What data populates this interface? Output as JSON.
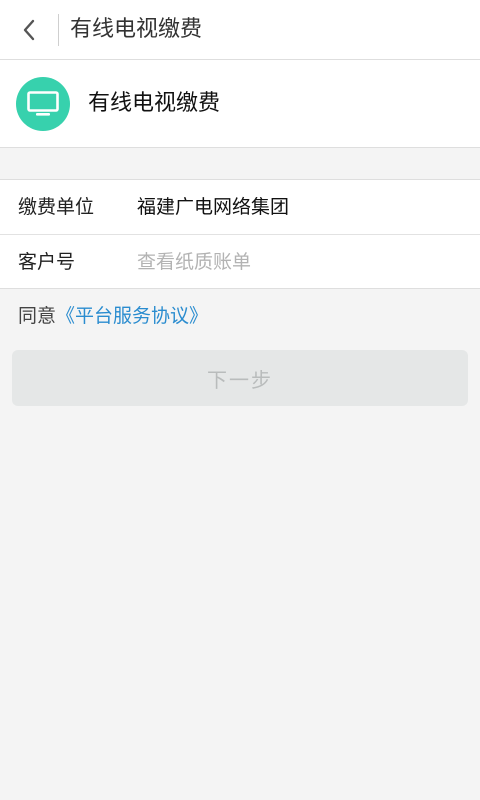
{
  "header": {
    "title": "有线电视缴费"
  },
  "service": {
    "name": "有线电视缴费",
    "icon": "tv-icon",
    "icon_color": "#37d1ad"
  },
  "form": {
    "payee_label": "缴费单位",
    "payee_value": "福建广电网络集团",
    "customer_label": "客户号",
    "customer_placeholder": "查看纸质账单",
    "customer_value": ""
  },
  "agreement": {
    "prefix": "同意",
    "link_text": "《平台服务协议》",
    "link_color": "#2a8ccf"
  },
  "actions": {
    "next_label": "下一步"
  }
}
